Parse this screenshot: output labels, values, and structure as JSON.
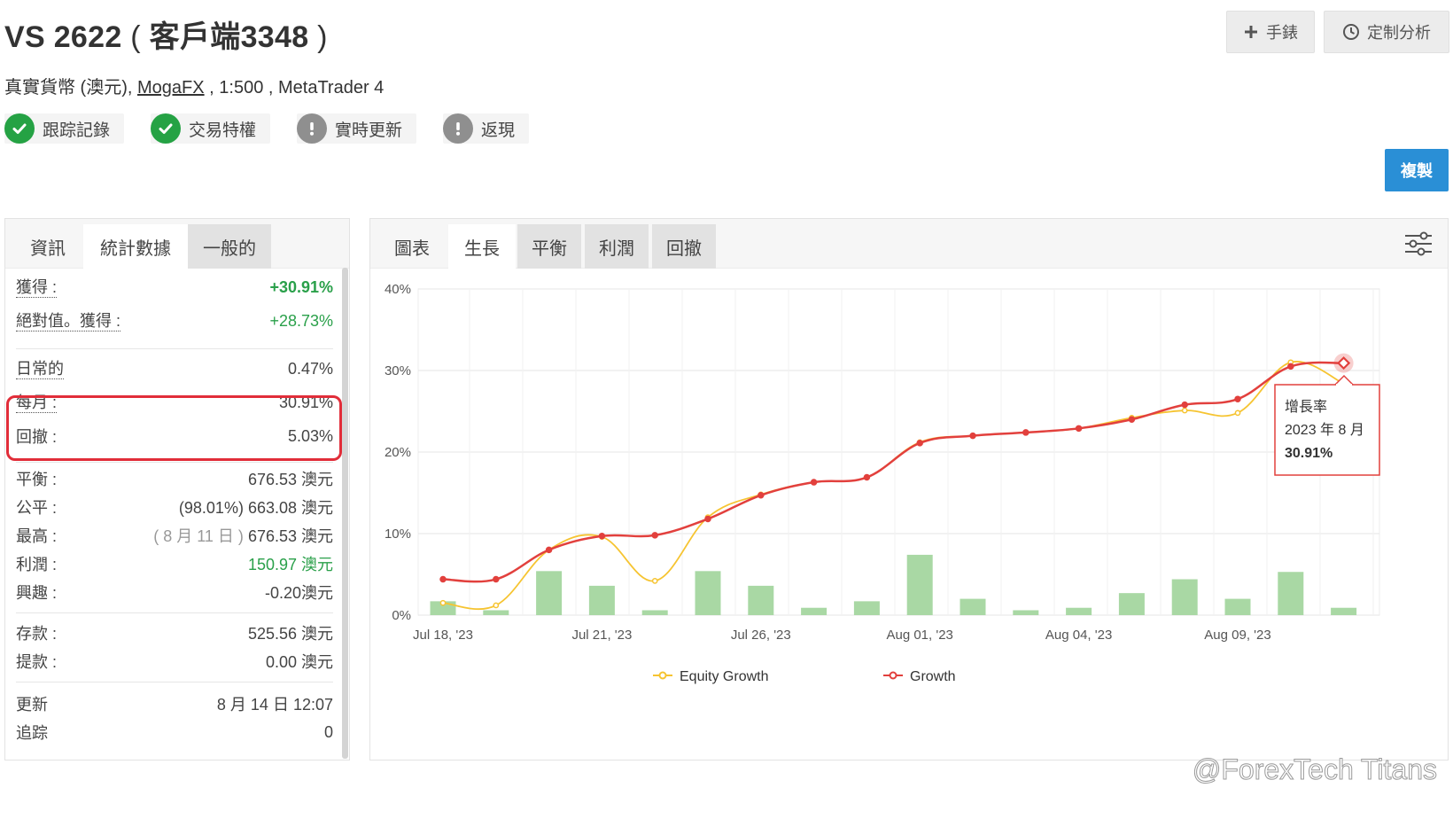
{
  "header": {
    "title_prefix": "VS 2622",
    "title_open": "(",
    "title_name": "客戶端3348",
    "title_close": ")",
    "subtitle_part1": "真實貨幣 (澳元),",
    "broker_link": "MogaFX",
    "subtitle_part2": ", 1:500 , MetaTrader 4"
  },
  "badges": [
    {
      "label": "跟踪記錄",
      "icon": "check-circle-icon",
      "status": "ok"
    },
    {
      "label": "交易特權",
      "icon": "check-circle-icon",
      "status": "ok"
    },
    {
      "label": "實時更新",
      "icon": "exclamation-circle-icon",
      "status": "warn"
    },
    {
      "label": "返現",
      "icon": "exclamation-circle-icon",
      "status": "warn"
    }
  ],
  "buttons": {
    "manual": "手錶",
    "custom": "定制分析",
    "copy": "複製"
  },
  "left_tabs": [
    "資訊",
    "統計數據",
    "一般的"
  ],
  "stats": {
    "gain_label": "獲得 :",
    "gain_value": "+30.91%",
    "abs_gain_label": "絕對值。獲得 :",
    "abs_gain_value": "+28.73%",
    "daily_label": "日常的",
    "daily_value": "0.47%",
    "monthly_label": "每月 :",
    "monthly_value": "30.91%",
    "drawdown_label": "回撤 :",
    "drawdown_value": "5.03%",
    "balance_label": "平衡 :",
    "balance_value": "676.53 澳元",
    "equity_label": "公平 :",
    "equity_value": "(98.01%) 663.08 澳元",
    "highest_label": "最高 :",
    "highest_date": "( 8 月 11 日 )",
    "highest_value": "676.53 澳元",
    "profit_label": "利潤 :",
    "profit_value": "150.97 澳元",
    "interest_label": "興趣 :",
    "interest_value": "-0.20澳元",
    "deposits_label": "存款 :",
    "deposits_value": "525.56 澳元",
    "withdrawals_label": "提款 :",
    "withdrawals_value": "0.00 澳元",
    "updated_label": "更新",
    "updated_value": "8 月 14 日 12:07",
    "tracking_label": "追踪",
    "tracking_value": "0"
  },
  "right_tabs": [
    "圖表",
    "生長",
    "平衡",
    "利潤",
    "回撤"
  ],
  "chart_data": {
    "type": "line",
    "x_tick_labels": [
      "Jul 18, '23",
      "Jul 21, '23",
      "Jul 26, '23",
      "Aug 01, '23",
      "Aug 04, '23",
      "Aug 09, '23"
    ],
    "y_tick_labels": [
      "0%",
      "10%",
      "20%",
      "30%",
      "40%"
    ],
    "ylim": [
      0,
      40
    ],
    "grid": true,
    "legend_position": "bottom",
    "series": [
      {
        "name": "Equity Growth",
        "color": "#f6c431",
        "values": [
          1.5,
          1.2,
          8.0,
          9.6,
          4.2,
          12.0,
          14.8,
          16.3,
          16.9,
          21.2,
          22.0,
          22.4,
          22.9,
          24.2,
          25.1,
          24.8,
          31.0,
          28.4
        ]
      },
      {
        "name": "Growth",
        "color": "#e2403d",
        "values": [
          4.4,
          4.4,
          8.0,
          9.7,
          9.8,
          11.8,
          14.7,
          16.3,
          16.9,
          21.1,
          22.0,
          22.4,
          22.9,
          24.0,
          25.8,
          26.5,
          30.5,
          30.91
        ]
      }
    ],
    "bars": {
      "color": "#a9d8a4",
      "values": [
        1.7,
        0.6,
        5.4,
        3.6,
        0.6,
        5.4,
        3.6,
        0.9,
        1.7,
        7.4,
        2.0,
        0.6,
        0.9,
        2.7,
        4.4,
        2.0,
        5.3,
        0.9
      ]
    },
    "tooltip": {
      "title": "增長率",
      "date": "2023 年 8 月",
      "value": "30.91%"
    }
  },
  "watermark": "@ForexTech Titans"
}
